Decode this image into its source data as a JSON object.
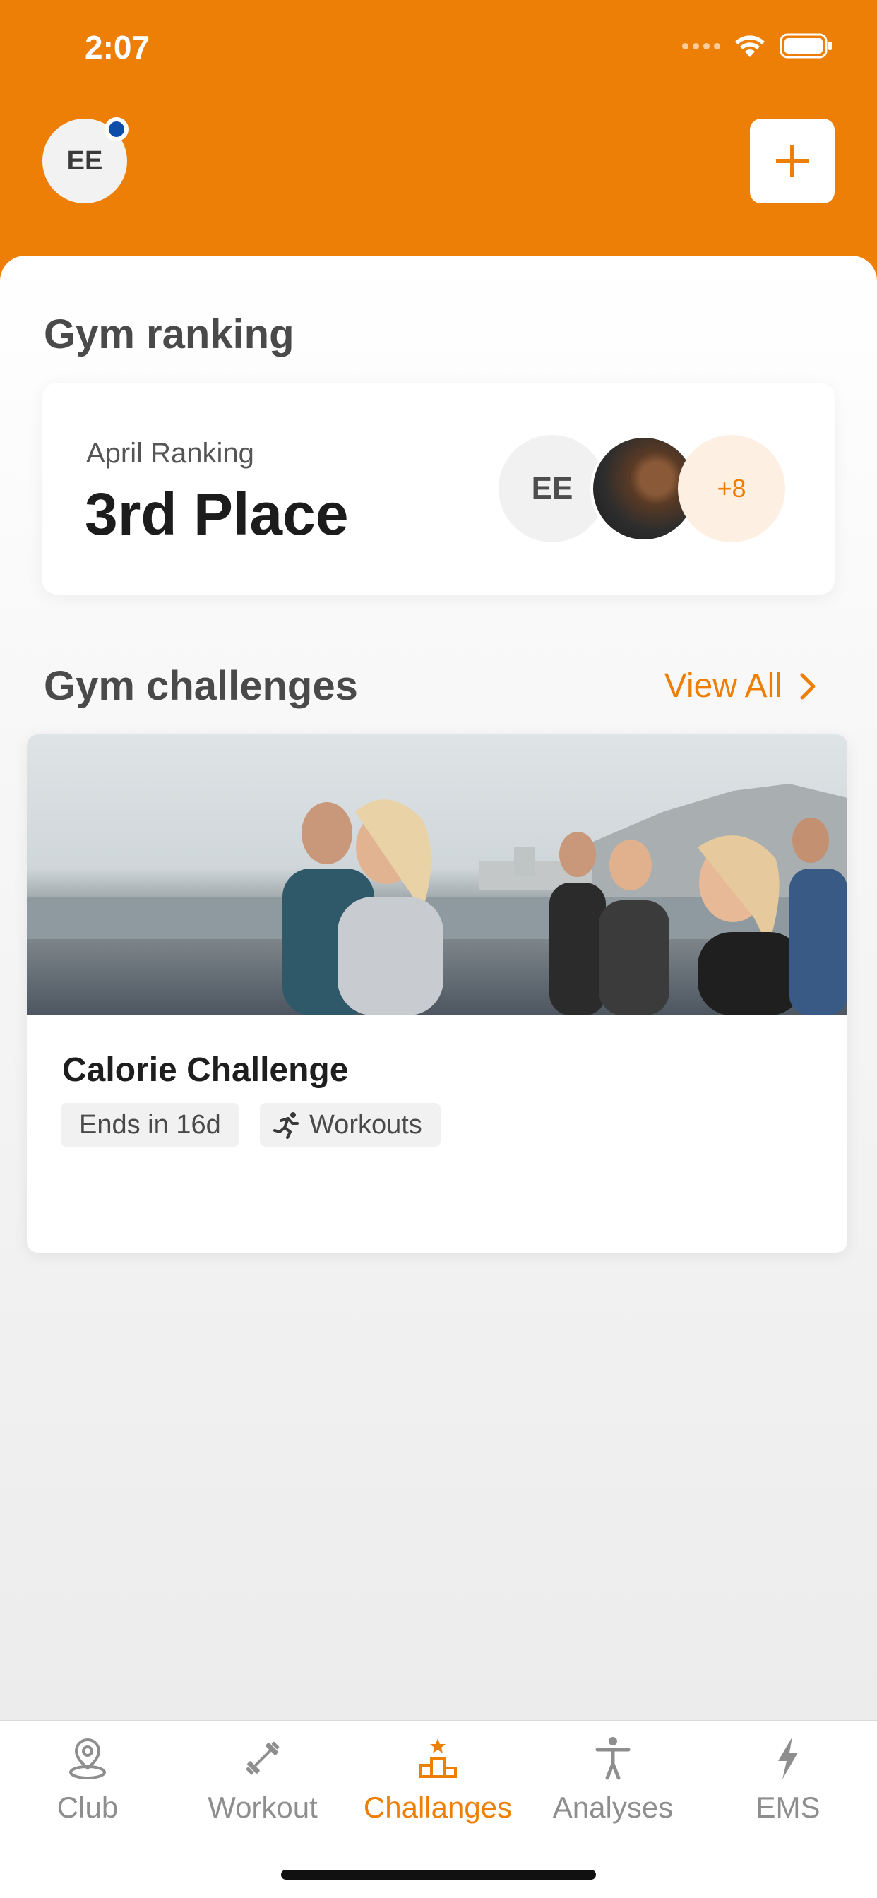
{
  "status_bar": {
    "time": "2:07"
  },
  "header": {
    "avatar_initials": "EE",
    "add_label": "+"
  },
  "ranking": {
    "section_title": "Gym ranking",
    "subtitle": "April Ranking",
    "place": "3rd Place",
    "avatars": {
      "first_initials": "EE",
      "more_count": "+8"
    }
  },
  "challenges": {
    "section_title": "Gym challenges",
    "view_all": "View All",
    "items": [
      {
        "title": "Calorie Challenge",
        "ends": "Ends in 16d",
        "category": "Workouts"
      }
    ]
  },
  "tabs": [
    {
      "label": "Club",
      "icon": "location-pin-icon",
      "active": false
    },
    {
      "label": "Workout",
      "icon": "dumbbell-icon",
      "active": false
    },
    {
      "label": "Challanges",
      "icon": "podium-star-icon",
      "active": true
    },
    {
      "label": "Analyses",
      "icon": "person-icon",
      "active": false
    },
    {
      "label": "EMS",
      "icon": "lightning-icon",
      "active": false
    }
  ],
  "colors": {
    "accent": "#EE7F06",
    "notification_dot": "#0f4ea8",
    "inactive_tab": "#8e8e8e"
  }
}
